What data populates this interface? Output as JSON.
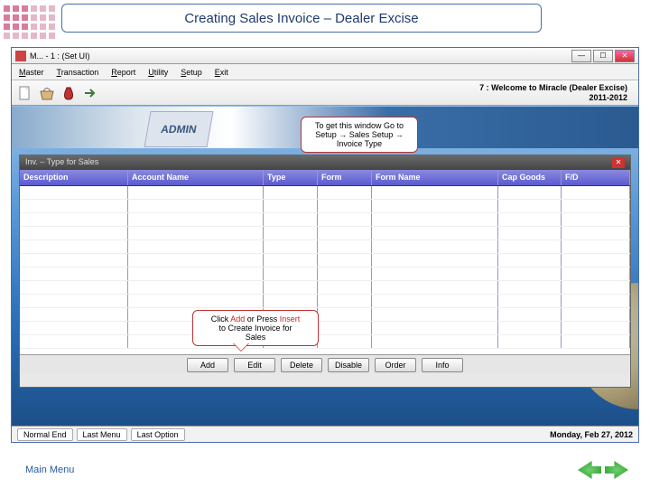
{
  "header_title": "Creating Sales Invoice – Dealer Excise",
  "window": {
    "title": "M... - 1 : (Set UI)"
  },
  "menu": {
    "master": "Master",
    "transaction": "Transaction",
    "report": "Report",
    "utility": "Utility",
    "setup": "Setup",
    "exit": "Exit"
  },
  "welcome": {
    "line1": "7 : Welcome to Miracle (Dealer Excise)",
    "line2": "2011-2012"
  },
  "admin_label": "ADMIN",
  "callout_top": {
    "l1": "To get this window Go to",
    "l2": "Setup → Sales Setup →",
    "l3": "Invoice Type"
  },
  "callout_bottom": {
    "l1": "Click ",
    "l1r": "Add ",
    "l1b": "or Press ",
    "l1r2": "Insert",
    "l2": "to Create Invoice for",
    "l3": "Sales"
  },
  "grid": {
    "title": "Inv. – Type for Sales",
    "columns": {
      "desc": "Description",
      "acct": "Account Name",
      "type": "Type",
      "form": "Form",
      "fname": "Form Name",
      "cap": "Cap Goods",
      "fd": "F/D"
    },
    "buttons": {
      "add": "Add",
      "edit": "Edit",
      "delete": "Delete",
      "disable": "Disable",
      "order": "Order",
      "info": "Info"
    }
  },
  "status": {
    "normal": "Normal End",
    "last_menu": "Last Menu",
    "last_option": "Last Option",
    "date": "Monday, Feb 27, 2012"
  },
  "footer": "Main Menu"
}
